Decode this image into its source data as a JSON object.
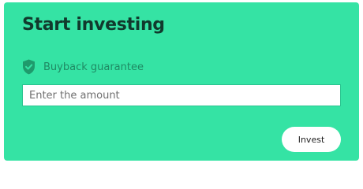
{
  "card": {
    "title": "Start investing",
    "guarantee": {
      "icon": "shield-check-icon",
      "label": "Buyback guarantee"
    },
    "amount_input": {
      "value": "",
      "placeholder": "Enter the amount"
    },
    "invest_button": {
      "label": "Invest"
    }
  },
  "colors": {
    "card_background": "#35e3a4",
    "title": "#113a2d",
    "guarantee_text": "#1f8a63",
    "button_background": "#ffffff"
  }
}
